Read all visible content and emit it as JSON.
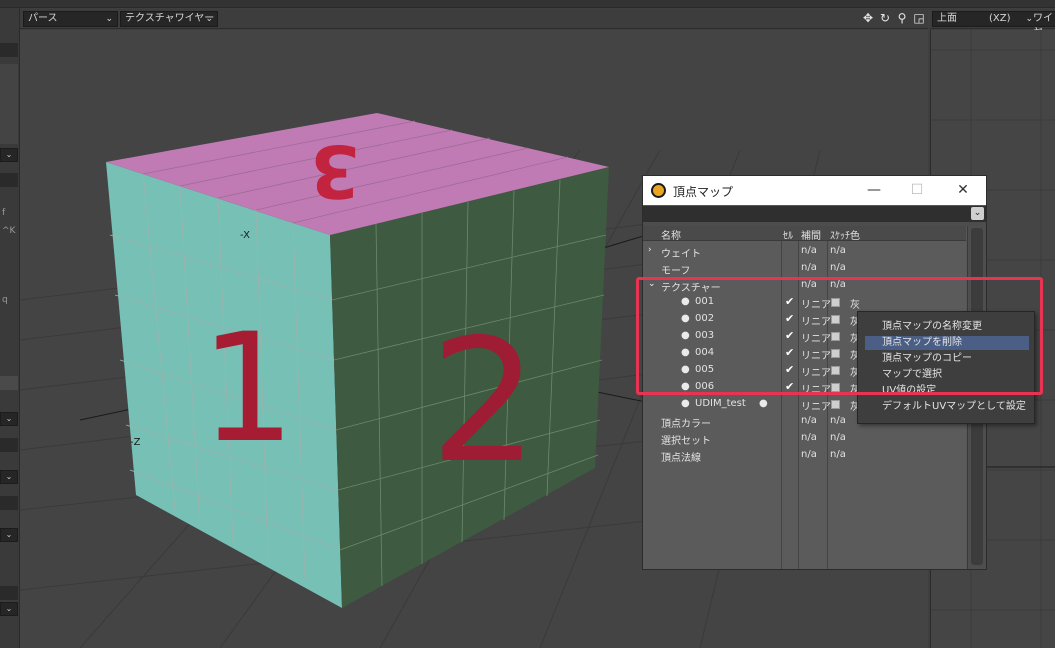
{
  "viewport": {
    "view_mode": "パース",
    "shading_mode": "テクスチャワイヤー",
    "axis_label_x": "-X",
    "axis_label_z": "-Z",
    "face_labels": {
      "top": "3",
      "left": "1",
      "right": "2"
    }
  },
  "right_viewport": {
    "view_mode": "上面",
    "axis": "(XZ)",
    "shading_mode": "ワイヤ"
  },
  "left_strip": {
    "keys": [
      "f",
      "^K",
      "q"
    ]
  },
  "dialog": {
    "title": "頂点マップ",
    "columns": {
      "name": "名称",
      "sel": "ｾﾙ",
      "interp": "補間",
      "sketch_color": "ｽｹｯﾁ色"
    },
    "rows": [
      {
        "chevron": "›",
        "name": "ウェイト",
        "interp": "n/a",
        "color": "n/a"
      },
      {
        "chevron": "",
        "name": "モーフ",
        "interp": "n/a",
        "color": "n/a"
      },
      {
        "chevron": "⌄",
        "name": "テクスチャー",
        "interp": "n/a",
        "color": "n/a"
      },
      {
        "dot": "●",
        "name": "001",
        "check": "✔",
        "interp": "リニア",
        "color": "灰"
      },
      {
        "dot": "●",
        "name": "002",
        "check": "✔",
        "interp": "リニア",
        "color": "灰"
      },
      {
        "dot": "●",
        "name": "003",
        "check": "✔",
        "interp": "リニア",
        "color": "灰"
      },
      {
        "dot": "●",
        "name": "004",
        "check": "✔",
        "interp": "リニア",
        "color": "灰"
      },
      {
        "dot": "●",
        "name": "005",
        "check": "✔",
        "interp": "リニア",
        "color": "灰"
      },
      {
        "dot": "●",
        "name": "006",
        "check": "✔",
        "interp": "リニア",
        "color": "灰"
      },
      {
        "dot": "●",
        "name": "UDIM_test",
        "marker": "●",
        "check": "",
        "interp": "リニア",
        "color": "灰"
      },
      {
        "chevron": "",
        "name": "頂点カラー",
        "interp": "n/a",
        "color": "n/a"
      },
      {
        "chevron": "",
        "name": "選択セット",
        "interp": "n/a",
        "color": "n/a"
      },
      {
        "chevron": "",
        "name": "頂点法線",
        "interp": "n/a",
        "color": "n/a"
      }
    ]
  },
  "context_menu": {
    "items": [
      "頂点マップの名称変更",
      "頂点マップを削除",
      "頂点マップのコピー",
      "マップで選択",
      "UV値の設定",
      "デフォルトUVマップとして設定"
    ],
    "highlighted_index": 1
  },
  "colors": {
    "highlight_box": "#e83452",
    "menu_highlight": "#4b5f86",
    "cube_left": "#77c0b6",
    "cube_right": "#3e5a40",
    "cube_top": "#c07bb4",
    "marker": "#c2233e"
  }
}
